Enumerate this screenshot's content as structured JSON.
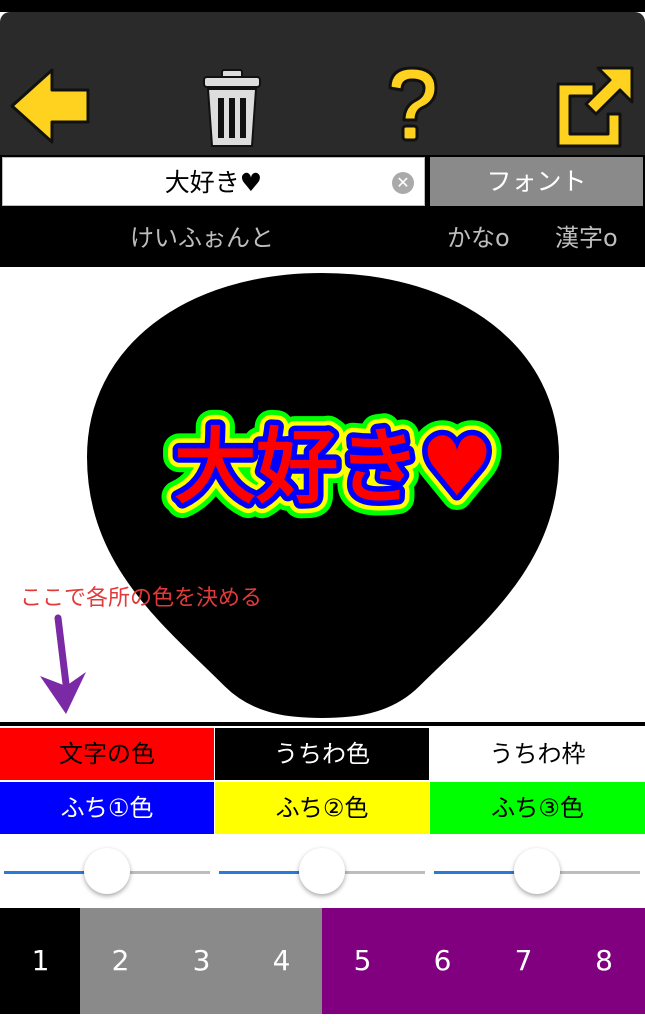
{
  "toolbar": {
    "back_icon": "back-arrow-icon",
    "delete_icon": "trash-icon",
    "help_icon": "question-icon",
    "share_icon": "share-icon"
  },
  "text_input": {
    "value": "大好き♥"
  },
  "font_button": {
    "label": "フォント"
  },
  "font_row": {
    "font_name": "けいふぉんと",
    "kana_label": "かなo",
    "kanji_label": "漢字o"
  },
  "preview": {
    "text": "大好き♥"
  },
  "annotation": {
    "text": "ここで各所の色を決める"
  },
  "color_buttons": [
    {
      "label": "文字の色",
      "bg": "#ff0000",
      "fg": "#000000"
    },
    {
      "label": "うちわ色",
      "bg": "#000000",
      "fg": "#ffffff"
    },
    {
      "label": "うちわ枠",
      "bg": "#ffffff",
      "fg": "#000000"
    },
    {
      "label": "ふち①色",
      "bg": "#0000ff",
      "fg": "#ffffff"
    },
    {
      "label": "ふち②色",
      "bg": "#ffff00",
      "fg": "#000000"
    },
    {
      "label": "ふち③色",
      "bg": "#00ff00",
      "fg": "#000000"
    }
  ],
  "sliders": [
    {
      "value": 0.5
    },
    {
      "value": 0.5
    },
    {
      "value": 0.5
    }
  ],
  "number_buttons": [
    {
      "label": "1",
      "bg": "#000000"
    },
    {
      "label": "2",
      "bg": "#8a8a8a"
    },
    {
      "label": "3",
      "bg": "#8a8a8a"
    },
    {
      "label": "4",
      "bg": "#8a8a8a"
    },
    {
      "label": "5",
      "bg": "#800080"
    },
    {
      "label": "6",
      "bg": "#800080"
    },
    {
      "label": "7",
      "bg": "#800080"
    },
    {
      "label": "8",
      "bg": "#800080"
    }
  ],
  "colors": {
    "toolbar_bg": "#2a2a2a",
    "icon_yellow": "#ffd21f",
    "annotation_red": "#e23a3a",
    "arrow_purple": "#7b2aa6",
    "slider_blue": "#2b7bd6"
  }
}
